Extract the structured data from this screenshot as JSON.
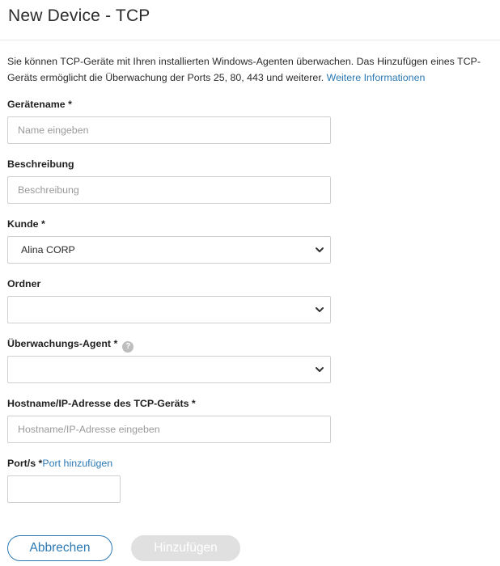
{
  "header": {
    "title": "New Device - TCP"
  },
  "intro": {
    "text": "Sie können TCP-Geräte mit Ihren installierten Windows-Agenten überwachen. Das Hinzufügen eines TCP-Geräts ermöglicht die Überwachung der Ports 25, 80, 443 und weiterer.",
    "link": "Weitere Informationen"
  },
  "form": {
    "device_name": {
      "label": "Gerätename *",
      "placeholder": "Name eingeben",
      "value": ""
    },
    "description": {
      "label": "Beschreibung",
      "placeholder": "Beschreibung",
      "value": ""
    },
    "customer": {
      "label": "Kunde *",
      "selected": "Alina CORP"
    },
    "folder": {
      "label": "Ordner",
      "selected": ""
    },
    "agent": {
      "label": "Überwachungs-Agent *",
      "help_icon": "question-circle-icon",
      "help_glyph": "?",
      "selected": ""
    },
    "hostname": {
      "label": "Hostname/IP-Adresse des TCP-Geräts *",
      "placeholder": "Hostname/IP-Adresse eingeben",
      "value": ""
    },
    "ports": {
      "label": "Port/s *",
      "add_link": "Port hinzufügen",
      "value": ""
    }
  },
  "buttons": {
    "cancel": "Abbrechen",
    "add": "Hinzufügen"
  },
  "colors": {
    "link": "#2b79b5",
    "border": "#cfcfcf",
    "disabled_button": "#e0e0e0"
  }
}
